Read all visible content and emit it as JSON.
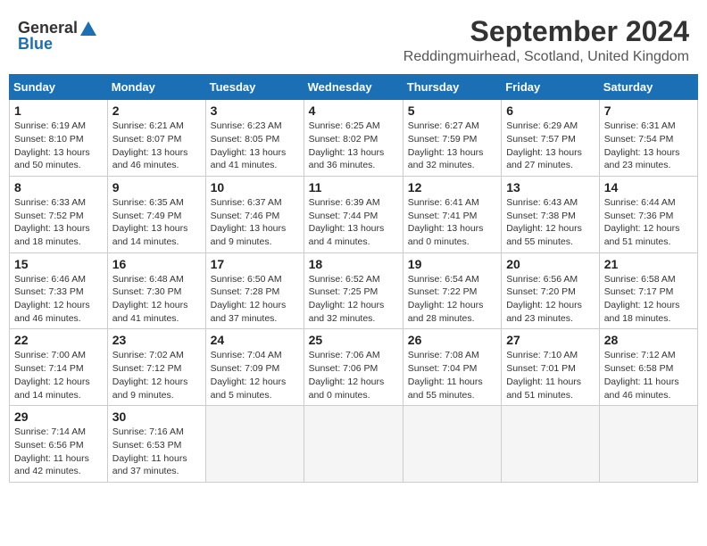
{
  "header": {
    "logo_general": "General",
    "logo_blue": "Blue",
    "month": "September 2024",
    "location": "Reddingmuirhead, Scotland, United Kingdom"
  },
  "weekdays": [
    "Sunday",
    "Monday",
    "Tuesday",
    "Wednesday",
    "Thursday",
    "Friday",
    "Saturday"
  ],
  "weeks": [
    [
      {
        "day": "1",
        "sunrise": "6:19 AM",
        "sunset": "8:10 PM",
        "daylight": "13 hours and 50 minutes."
      },
      {
        "day": "2",
        "sunrise": "6:21 AM",
        "sunset": "8:07 PM",
        "daylight": "13 hours and 46 minutes."
      },
      {
        "day": "3",
        "sunrise": "6:23 AM",
        "sunset": "8:05 PM",
        "daylight": "13 hours and 41 minutes."
      },
      {
        "day": "4",
        "sunrise": "6:25 AM",
        "sunset": "8:02 PM",
        "daylight": "13 hours and 36 minutes."
      },
      {
        "day": "5",
        "sunrise": "6:27 AM",
        "sunset": "7:59 PM",
        "daylight": "13 hours and 32 minutes."
      },
      {
        "day": "6",
        "sunrise": "6:29 AM",
        "sunset": "7:57 PM",
        "daylight": "13 hours and 27 minutes."
      },
      {
        "day": "7",
        "sunrise": "6:31 AM",
        "sunset": "7:54 PM",
        "daylight": "13 hours and 23 minutes."
      }
    ],
    [
      {
        "day": "8",
        "sunrise": "6:33 AM",
        "sunset": "7:52 PM",
        "daylight": "13 hours and 18 minutes."
      },
      {
        "day": "9",
        "sunrise": "6:35 AM",
        "sunset": "7:49 PM",
        "daylight": "13 hours and 14 minutes."
      },
      {
        "day": "10",
        "sunrise": "6:37 AM",
        "sunset": "7:46 PM",
        "daylight": "13 hours and 9 minutes."
      },
      {
        "day": "11",
        "sunrise": "6:39 AM",
        "sunset": "7:44 PM",
        "daylight": "13 hours and 4 minutes."
      },
      {
        "day": "12",
        "sunrise": "6:41 AM",
        "sunset": "7:41 PM",
        "daylight": "13 hours and 0 minutes."
      },
      {
        "day": "13",
        "sunrise": "6:43 AM",
        "sunset": "7:38 PM",
        "daylight": "12 hours and 55 minutes."
      },
      {
        "day": "14",
        "sunrise": "6:44 AM",
        "sunset": "7:36 PM",
        "daylight": "12 hours and 51 minutes."
      }
    ],
    [
      {
        "day": "15",
        "sunrise": "6:46 AM",
        "sunset": "7:33 PM",
        "daylight": "12 hours and 46 minutes."
      },
      {
        "day": "16",
        "sunrise": "6:48 AM",
        "sunset": "7:30 PM",
        "daylight": "12 hours and 41 minutes."
      },
      {
        "day": "17",
        "sunrise": "6:50 AM",
        "sunset": "7:28 PM",
        "daylight": "12 hours and 37 minutes."
      },
      {
        "day": "18",
        "sunrise": "6:52 AM",
        "sunset": "7:25 PM",
        "daylight": "12 hours and 32 minutes."
      },
      {
        "day": "19",
        "sunrise": "6:54 AM",
        "sunset": "7:22 PM",
        "daylight": "12 hours and 28 minutes."
      },
      {
        "day": "20",
        "sunrise": "6:56 AM",
        "sunset": "7:20 PM",
        "daylight": "12 hours and 23 minutes."
      },
      {
        "day": "21",
        "sunrise": "6:58 AM",
        "sunset": "7:17 PM",
        "daylight": "12 hours and 18 minutes."
      }
    ],
    [
      {
        "day": "22",
        "sunrise": "7:00 AM",
        "sunset": "7:14 PM",
        "daylight": "12 hours and 14 minutes."
      },
      {
        "day": "23",
        "sunrise": "7:02 AM",
        "sunset": "7:12 PM",
        "daylight": "12 hours and 9 minutes."
      },
      {
        "day": "24",
        "sunrise": "7:04 AM",
        "sunset": "7:09 PM",
        "daylight": "12 hours and 5 minutes."
      },
      {
        "day": "25",
        "sunrise": "7:06 AM",
        "sunset": "7:06 PM",
        "daylight": "12 hours and 0 minutes."
      },
      {
        "day": "26",
        "sunrise": "7:08 AM",
        "sunset": "7:04 PM",
        "daylight": "11 hours and 55 minutes."
      },
      {
        "day": "27",
        "sunrise": "7:10 AM",
        "sunset": "7:01 PM",
        "daylight": "11 hours and 51 minutes."
      },
      {
        "day": "28",
        "sunrise": "7:12 AM",
        "sunset": "6:58 PM",
        "daylight": "11 hours and 46 minutes."
      }
    ],
    [
      {
        "day": "29",
        "sunrise": "7:14 AM",
        "sunset": "6:56 PM",
        "daylight": "11 hours and 42 minutes."
      },
      {
        "day": "30",
        "sunrise": "7:16 AM",
        "sunset": "6:53 PM",
        "daylight": "11 hours and 37 minutes."
      },
      null,
      null,
      null,
      null,
      null
    ]
  ]
}
